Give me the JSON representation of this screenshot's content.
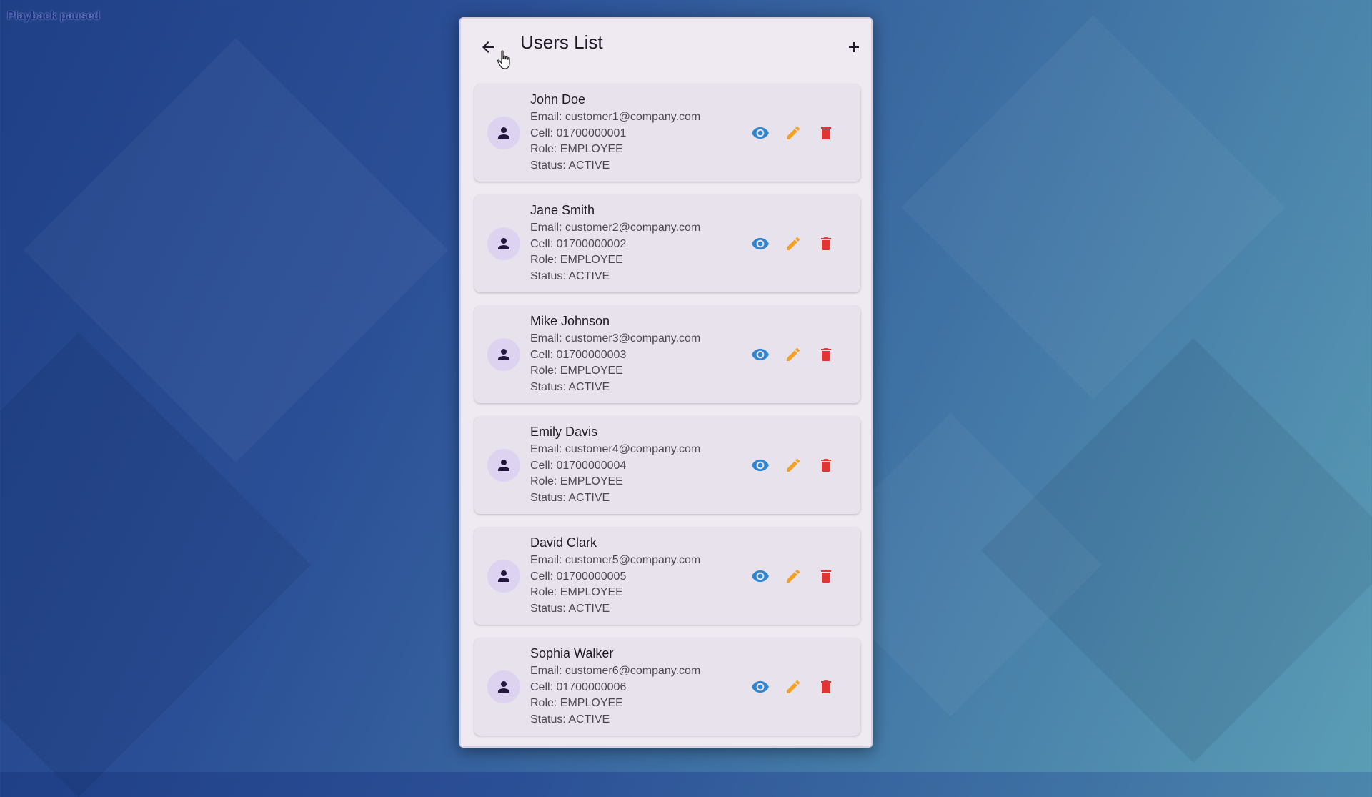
{
  "overlay": {
    "playback_text": "Playback paused"
  },
  "appbar": {
    "title": "Users List",
    "back_icon": "arrow-back-icon",
    "add_icon": "add-icon"
  },
  "colors": {
    "view": "#2d86cf",
    "edit": "#f5a020",
    "delete": "#e03535",
    "avatar_bg": "#ddd2ef",
    "avatar_icon": "#23173f"
  },
  "users": [
    {
      "name": "John Doe",
      "email": "Email: customer1@company.com",
      "cell": "Cell: 01700000001",
      "role": "Role: EMPLOYEE",
      "status": "Status: ACTIVE"
    },
    {
      "name": "Jane Smith",
      "email": "Email: customer2@company.com",
      "cell": "Cell: 01700000002",
      "role": "Role: EMPLOYEE",
      "status": "Status: ACTIVE"
    },
    {
      "name": "Mike Johnson",
      "email": "Email: customer3@company.com",
      "cell": "Cell: 01700000003",
      "role": "Role: EMPLOYEE",
      "status": "Status: ACTIVE"
    },
    {
      "name": "Emily Davis",
      "email": "Email: customer4@company.com",
      "cell": "Cell: 01700000004",
      "role": "Role: EMPLOYEE",
      "status": "Status: ACTIVE"
    },
    {
      "name": "David Clark",
      "email": "Email: customer5@company.com",
      "cell": "Cell: 01700000005",
      "role": "Role: EMPLOYEE",
      "status": "Status: ACTIVE"
    },
    {
      "name": "Sophia Walker",
      "email": "Email: customer6@company.com",
      "cell": "Cell: 01700000006",
      "role": "Role: EMPLOYEE",
      "status": "Status: ACTIVE"
    }
  ]
}
